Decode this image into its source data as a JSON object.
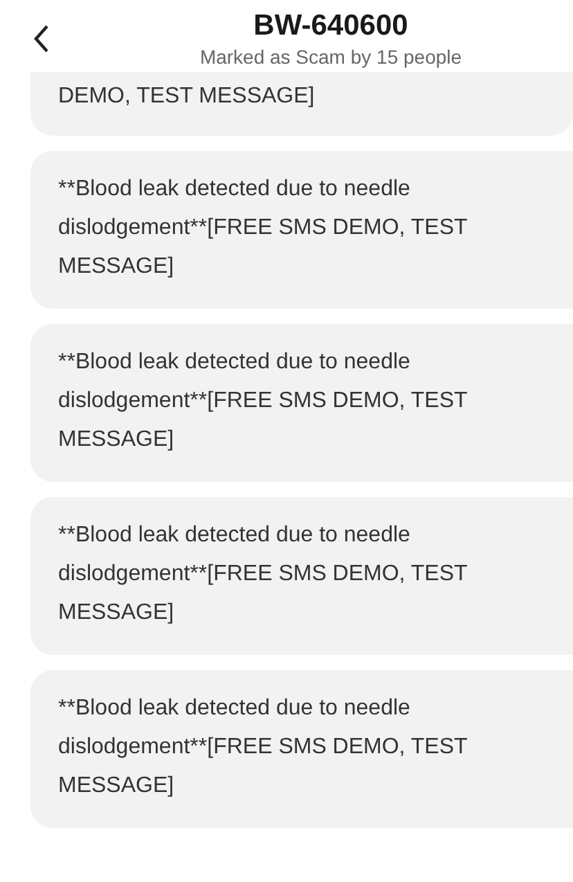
{
  "header": {
    "title": "BW-640600",
    "subtitle": "Marked as Scam by 15 people"
  },
  "messages": [
    {
      "text": "DEMO, TEST MESSAGE]",
      "partial": true
    },
    {
      "text": "**Blood leak detected due to needle dislodgement**[FREE SMS DEMO, TEST MESSAGE]",
      "partial": false
    },
    {
      "text": "**Blood leak detected due to needle dislodgement**[FREE SMS DEMO, TEST MESSAGE]",
      "partial": false
    },
    {
      "text": "**Blood leak detected due to needle dislodgement**[FREE SMS DEMO, TEST MESSAGE]",
      "partial": false
    },
    {
      "text": "**Blood leak detected due to needle dislodgement**[FREE SMS DEMO, TEST MESSAGE]",
      "partial": false
    }
  ]
}
